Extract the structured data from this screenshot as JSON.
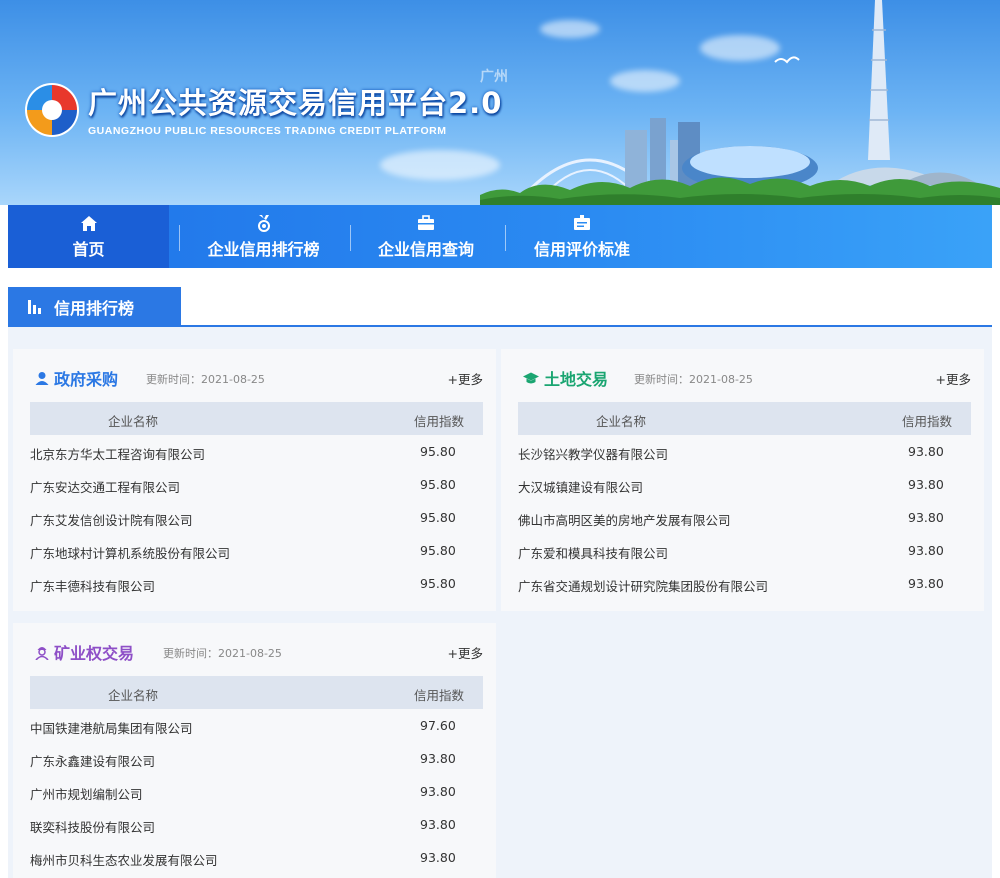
{
  "header": {
    "title": "广州公共资源交易信用平台2.0",
    "subtitle": "GUANGZHOU PUBLIC RESOURCES TRADING CREDIT PLATFORM",
    "watermark": "广州"
  },
  "nav": {
    "items": [
      {
        "label": "首页",
        "icon": "home-icon",
        "active": true
      },
      {
        "label": "企业信用排行榜",
        "icon": "medal-icon",
        "active": false
      },
      {
        "label": "企业信用查询",
        "icon": "briefcase-icon",
        "active": false
      },
      {
        "label": "信用评价标准",
        "icon": "id-card-icon",
        "active": false
      }
    ]
  },
  "section": {
    "title": "信用排行榜",
    "icon": "bar-chart-icon"
  },
  "cards": {
    "gov": {
      "title": "政府采购",
      "icon": "user-icon",
      "color": "#2b78e4",
      "time": "更新时间：2021-08-25",
      "more": "+更多",
      "col_name": "企业名称",
      "col_score": "信用指数",
      "rows": [
        {
          "name": "北京东方华太工程咨询有限公司",
          "score": "95.80"
        },
        {
          "name": "广东安达交通工程有限公司",
          "score": "95.80"
        },
        {
          "name": "广东艾发信创设计院有限公司",
          "score": "95.80"
        },
        {
          "name": "广东地球村计算机系统股份有限公司",
          "score": "95.80"
        },
        {
          "name": "广东丰德科技有限公司",
          "score": "95.80"
        }
      ]
    },
    "land": {
      "title": "土地交易",
      "icon": "graduation-cap-icon",
      "color": "#1aa571",
      "time": "更新时间：2021-08-25",
      "more": "+更多",
      "col_name": "企业名称",
      "col_score": "信用指数",
      "rows": [
        {
          "name": "长沙铭兴教学仪器有限公司",
          "score": "93.80"
        },
        {
          "name": "大汉城镇建设有限公司",
          "score": "93.80"
        },
        {
          "name": "佛山市高明区美的房地产发展有限公司",
          "score": "93.80"
        },
        {
          "name": "广东爱和模具科技有限公司",
          "score": "93.80"
        },
        {
          "name": "广东省交通规划设计研究院集团股份有限公司",
          "score": "93.80"
        }
      ]
    },
    "mine": {
      "title": "矿业权交易",
      "icon": "worker-icon",
      "color": "#8e4fc7",
      "time": "更新时间：2021-08-25",
      "more": "+更多",
      "col_name": "企业名称",
      "col_score": "信用指数",
      "rows": [
        {
          "name": "中国铁建港航局集团有限公司",
          "score": "97.60"
        },
        {
          "name": "广东永鑫建设有限公司",
          "score": "93.80"
        },
        {
          "name": "广州市规划编制公司",
          "score": "93.80"
        },
        {
          "name": "联奕科技股份有限公司",
          "score": "93.80"
        },
        {
          "name": "梅州市贝科生态农业发展有限公司",
          "score": "93.80"
        }
      ]
    }
  }
}
